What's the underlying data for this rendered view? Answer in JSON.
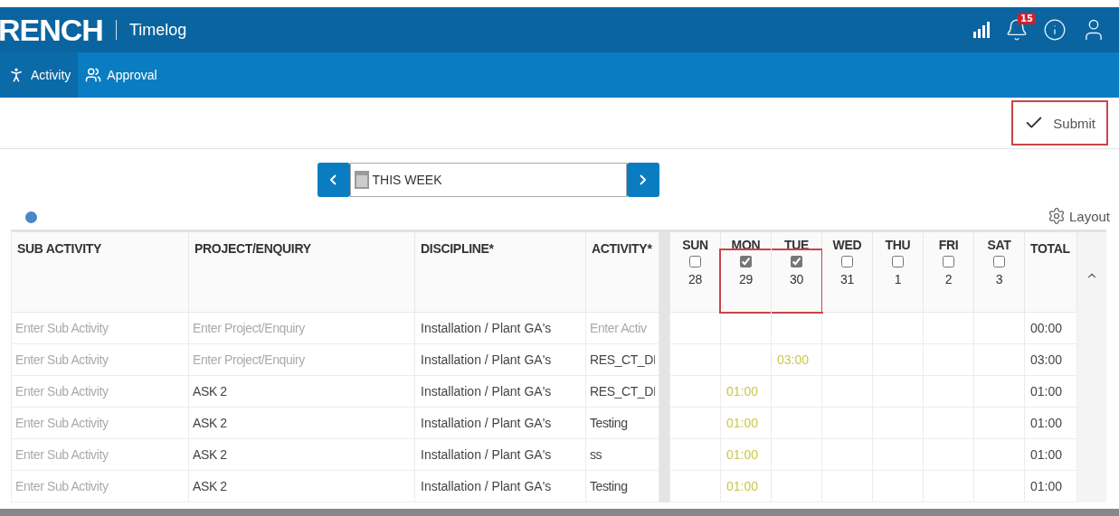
{
  "header": {
    "logo": "RENCH",
    "title": "Timelog",
    "notifications": "15"
  },
  "nav": [
    {
      "label": "Activity",
      "selected": true
    },
    {
      "label": "Approval",
      "selected": false
    }
  ],
  "submit": {
    "label": "Submit",
    "highlighted": true
  },
  "week_picker": {
    "value": "THIS WEEK"
  },
  "layout_button": "Layout",
  "table": {
    "columns": [
      "SUB ACTIVITY",
      "PROJECT/ENQUIRY",
      "DISCIPLINE*",
      "ACTIVITY*"
    ],
    "days": [
      {
        "name": "SUN",
        "date": "28",
        "checked": false,
        "highlighted": false
      },
      {
        "name": "MON",
        "date": "29",
        "checked": true,
        "highlighted": true
      },
      {
        "name": "TUE",
        "date": "30",
        "checked": true,
        "highlighted": true
      },
      {
        "name": "WED",
        "date": "31",
        "checked": false,
        "highlighted": false
      },
      {
        "name": "THU",
        "date": "1",
        "checked": false,
        "highlighted": false
      },
      {
        "name": "FRI",
        "date": "2",
        "checked": false,
        "highlighted": false
      },
      {
        "name": "SAT",
        "date": "3",
        "checked": false,
        "highlighted": false
      }
    ],
    "total_label": "TOTAL",
    "rows": [
      {
        "sub_activity": {
          "placeholder": "Enter Sub Activity"
        },
        "project": {
          "placeholder": "Enter Project/Enquiry"
        },
        "discipline": "Installation / Plant GA's",
        "activity": {
          "placeholder": "Enter Activ"
        },
        "hours": {},
        "total": "00:00"
      },
      {
        "sub_activity": {
          "placeholder": "Enter Sub Activity"
        },
        "project": {
          "placeholder": "Enter Project/Enquiry"
        },
        "discipline": "Installation / Plant GA's",
        "activity": {
          "value": "RES_CT_DI"
        },
        "hours": {
          "tue": "03:00"
        },
        "total": "03:00"
      },
      {
        "sub_activity": {
          "placeholder": "Enter Sub Activity"
        },
        "project": {
          "value": "ASK 2"
        },
        "discipline": "Installation / Plant GA's",
        "activity": {
          "value": "RES_CT_DI"
        },
        "hours": {
          "mon": "01:00"
        },
        "total": "01:00"
      },
      {
        "sub_activity": {
          "placeholder": "Enter Sub Activity"
        },
        "project": {
          "value": "ASK 2"
        },
        "discipline": "Installation / Plant GA's",
        "activity": {
          "value": "Testing"
        },
        "hours": {
          "mon": "01:00"
        },
        "total": "01:00"
      },
      {
        "sub_activity": {
          "placeholder": "Enter Sub Activity"
        },
        "project": {
          "value": "ASK 2"
        },
        "discipline": "Installation / Plant GA's",
        "activity": {
          "value": "ss"
        },
        "hours": {
          "mon": "01:00"
        },
        "total": "01:00"
      },
      {
        "sub_activity": {
          "placeholder": "Enter Sub Activity"
        },
        "project": {
          "value": "ASK 2"
        },
        "discipline": "Installation / Plant GA's",
        "activity": {
          "value": "Testing"
        },
        "hours": {
          "mon": "01:00"
        },
        "total": "01:00"
      }
    ]
  }
}
